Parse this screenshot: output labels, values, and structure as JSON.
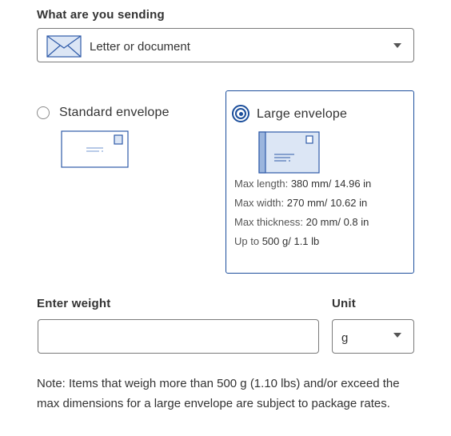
{
  "sending": {
    "label": "What are you sending",
    "selected_value": "Letter or document",
    "icon": "envelope-icon"
  },
  "envelope_options": {
    "standard": {
      "label": "Standard envelope",
      "selected": false
    },
    "large": {
      "label": "Large envelope",
      "selected": true,
      "specs": {
        "length_key": "Max length:",
        "length_value": "380 mm/ 14.96 in",
        "width_key": "Max width:",
        "width_value": "270 mm/ 10.62 in",
        "thickness_key": "Max thickness:",
        "thickness_value": "20 mm/ 0.8 in",
        "weight_key": "Up to",
        "weight_value": "500 g/ 1.1 lb"
      }
    }
  },
  "weight": {
    "label": "Enter weight",
    "value": ""
  },
  "unit": {
    "label": "Unit",
    "selected_value": "g"
  },
  "note": "Note: Items that weigh more than 500 g (1.10 lbs) and/or exceed the max dimensions for a large envelope are subject to package rates.",
  "colors": {
    "accent": "#1c4f9c",
    "envelope_fill": "#dce6f5",
    "envelope_stroke": "#2e5aa8"
  }
}
